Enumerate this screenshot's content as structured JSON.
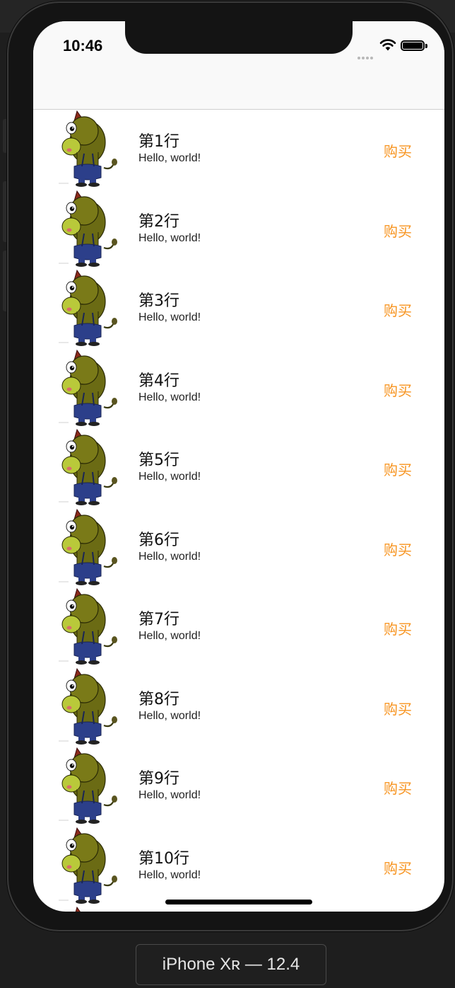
{
  "status_bar": {
    "time": "10:46"
  },
  "colors": {
    "accent": "#f7931e",
    "screen_bg": "#ffffff",
    "navbar_bg": "#f9f9f9",
    "device_bg": "#1e1e1e"
  },
  "rows": [
    {
      "title": "第1行",
      "subtitle": "Hello, world!",
      "action": "购买",
      "thumbnail": "cartoon-bull-image"
    },
    {
      "title": "第2行",
      "subtitle": "Hello, world!",
      "action": "购买",
      "thumbnail": "cartoon-bull-image"
    },
    {
      "title": "第3行",
      "subtitle": "Hello, world!",
      "action": "购买",
      "thumbnail": "cartoon-bull-image"
    },
    {
      "title": "第4行",
      "subtitle": "Hello, world!",
      "action": "购买",
      "thumbnail": "cartoon-bull-image"
    },
    {
      "title": "第5行",
      "subtitle": "Hello, world!",
      "action": "购买",
      "thumbnail": "cartoon-bull-image"
    },
    {
      "title": "第6行",
      "subtitle": "Hello, world!",
      "action": "购买",
      "thumbnail": "cartoon-bull-image"
    },
    {
      "title": "第7行",
      "subtitle": "Hello, world!",
      "action": "购买",
      "thumbnail": "cartoon-bull-image"
    },
    {
      "title": "第8行",
      "subtitle": "Hello, world!",
      "action": "购买",
      "thumbnail": "cartoon-bull-image"
    },
    {
      "title": "第9行",
      "subtitle": "Hello, world!",
      "action": "购买",
      "thumbnail": "cartoon-bull-image"
    },
    {
      "title": "第10行",
      "subtitle": "Hello, world!",
      "action": "购买",
      "thumbnail": "cartoon-bull-image"
    },
    {
      "title": "",
      "subtitle": "",
      "action": "",
      "thumbnail": "cartoon-bull-image"
    }
  ],
  "device_label": "iPhone Xʀ — 12.4"
}
